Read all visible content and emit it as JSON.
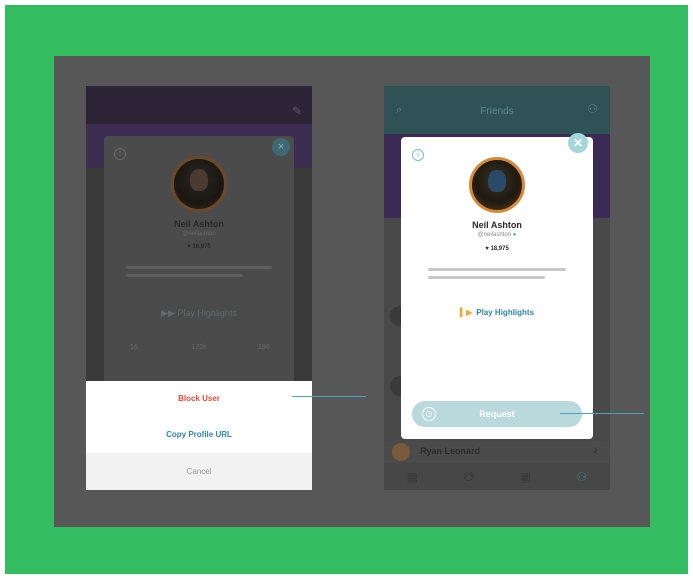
{
  "colors": {
    "page_bg": "#33bd60",
    "board_bg": "#575757",
    "accent": "#2f86a8",
    "danger": "#e14b3b"
  },
  "left_screen": {
    "profile": {
      "name": "Neil Ashton",
      "subtitle": "@neilashton",
      "heart_count": "18,975"
    },
    "highlights_label": "Play Highlights",
    "stats": [
      "16",
      "172k",
      "196"
    ],
    "action_sheet": {
      "block_label": "Block User",
      "copy_label": "Copy Profile URL",
      "cancel_label": "Cancel"
    }
  },
  "right_screen": {
    "header_title": "Friends",
    "profile": {
      "name": "Neil Ashton",
      "subtitle": "@neilashton",
      "heart_count": "18,975"
    },
    "play_label": "Play Highlights",
    "request_button_label": "Request",
    "list_row_name": "Ryan Leonard",
    "icons": {
      "close": "close-icon",
      "info": "info-icon",
      "play": "play-icon",
      "clock": "clock-icon"
    }
  }
}
